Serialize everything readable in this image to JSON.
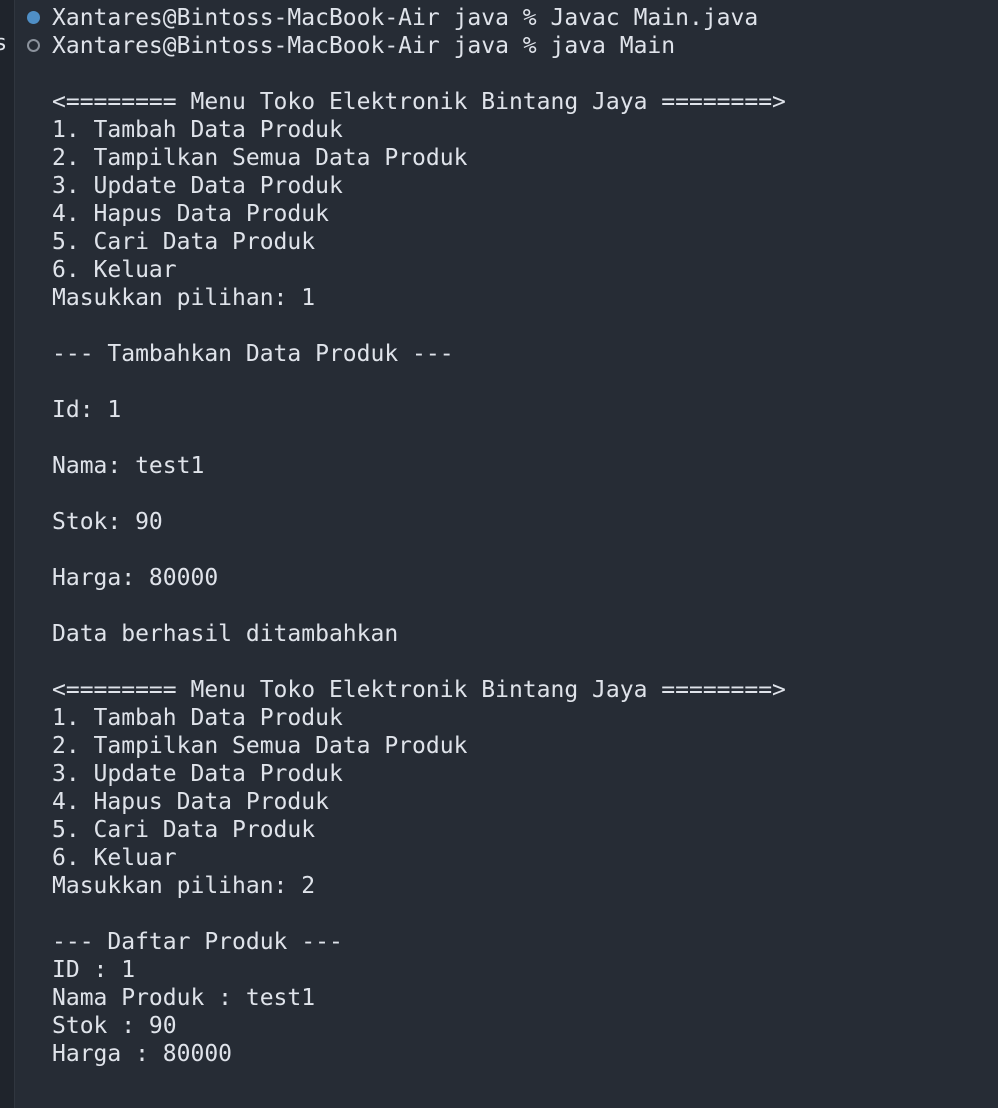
{
  "terminal": {
    "commands": [
      {
        "text": "Xantares@Bintoss-MacBook-Air java % Javac Main.java",
        "status": "success",
        "marker_color": "#4f8fc6"
      },
      {
        "text": "Xantares@Bintoss-MacBook-Air java % java Main",
        "status": "running",
        "marker_color": "#8b929c"
      }
    ],
    "output_lines": [
      "<======== Menu Toko Elektronik Bintang Jaya ========>",
      "1. Tambah Data Produk",
      "2. Tampilkan Semua Data Produk",
      "3. Update Data Produk",
      "4. Hapus Data Produk",
      "5. Cari Data Produk",
      "6. Keluar",
      "Masukkan pilihan: 1",
      "",
      "--- Tambahkan Data Produk ---",
      "",
      "Id: 1",
      "",
      "Nama: test1",
      "",
      "Stok: 90",
      "",
      "Harga: 80000",
      "",
      "Data berhasil ditambahkan",
      "",
      "<======== Menu Toko Elektronik Bintang Jaya ========>",
      "1. Tambah Data Produk",
      "2. Tampilkan Semua Data Produk",
      "3. Update Data Produk",
      "4. Hapus Data Produk",
      "5. Cari Data Produk",
      "6. Keluar",
      "Masukkan pilihan: 2",
      "",
      "--- Daftar Produk ---",
      "ID : 1",
      "Nama Produk : test1",
      "Stok : 90",
      "Harga : 80000"
    ]
  },
  "colors": {
    "background": "#262c35",
    "text": "#dfe3ea",
    "success_marker": "#4f8fc6",
    "neutral_marker": "#8b929c"
  }
}
